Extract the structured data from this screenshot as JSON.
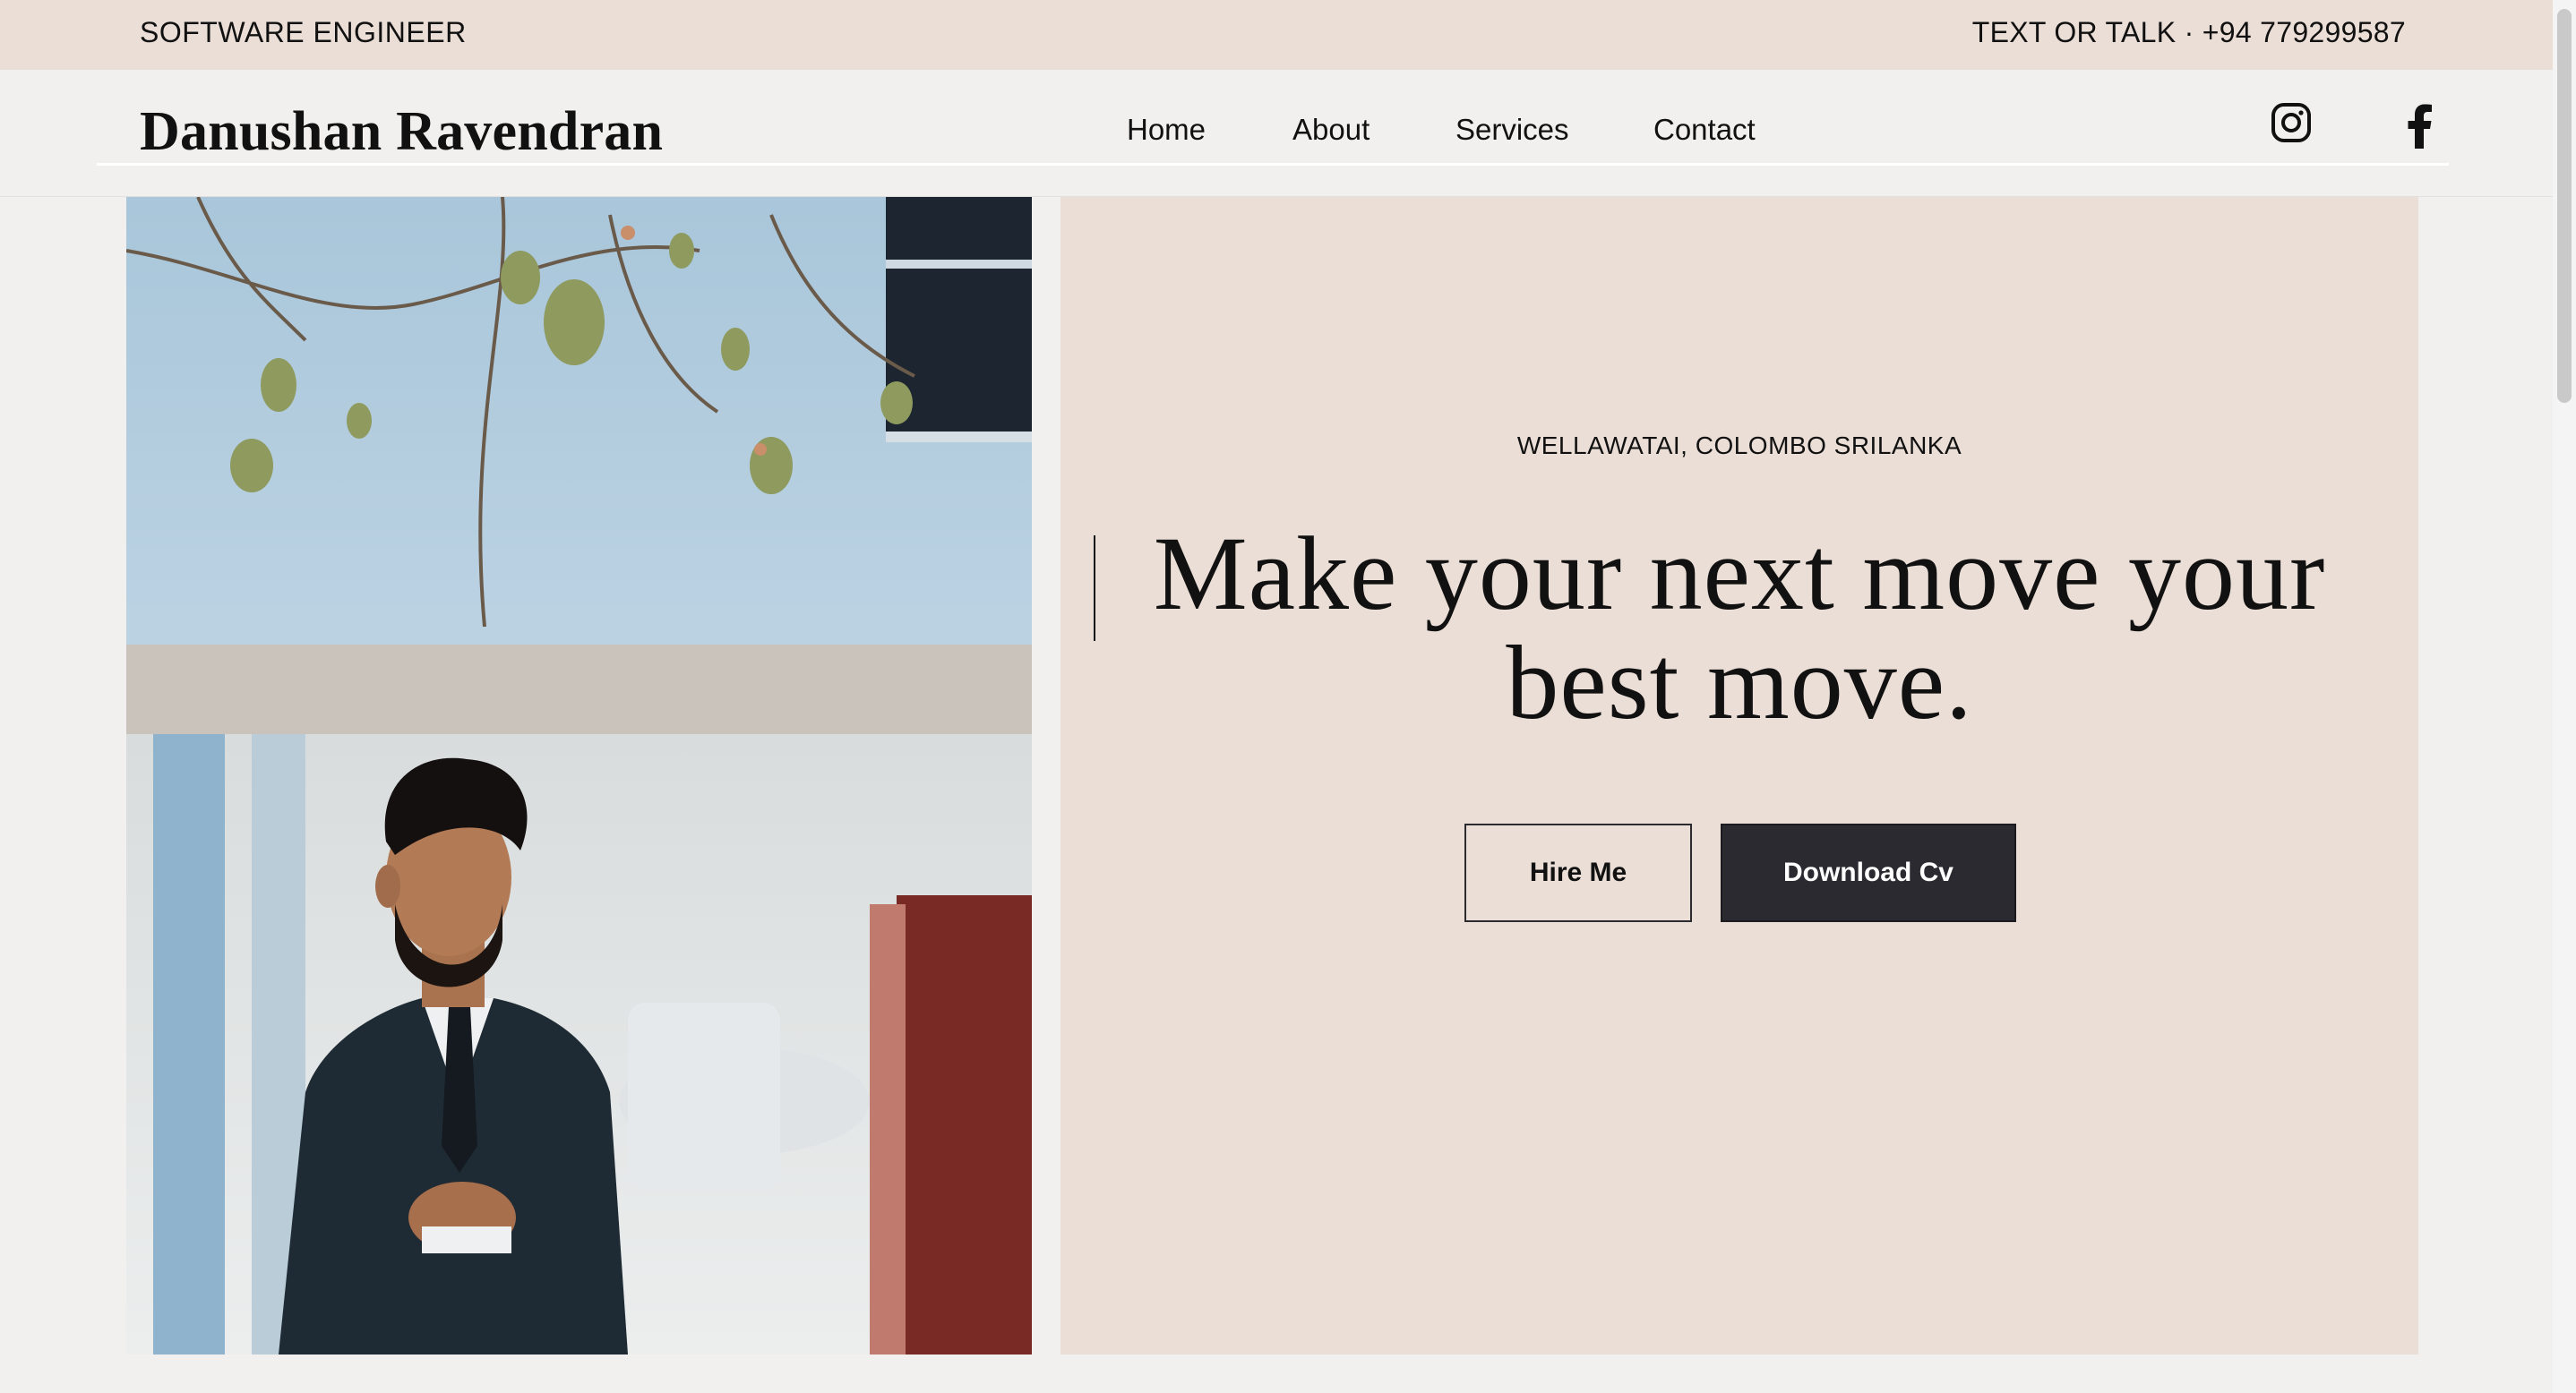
{
  "topbar": {
    "role": "SOFTWARE ENGINEER",
    "contact": "TEXT OR TALK · +94 779299587"
  },
  "header": {
    "brand": "Danushan Ravendran",
    "nav": [
      "Home",
      "About",
      "Services",
      "Contact"
    ],
    "social": [
      "instagram-icon",
      "facebook-icon"
    ]
  },
  "hero": {
    "photo": "portrait-photo",
    "location": "WELLAWATAI, COLOMBO SRILANKA",
    "headline": "Make your next move your best move.",
    "buttons": {
      "hire": "Hire Me",
      "cv": "Download Cv"
    }
  },
  "colors": {
    "accent_bg": "#ebded6",
    "page_bg": "#f1f0ee",
    "dark_button": "#2a2a30"
  }
}
